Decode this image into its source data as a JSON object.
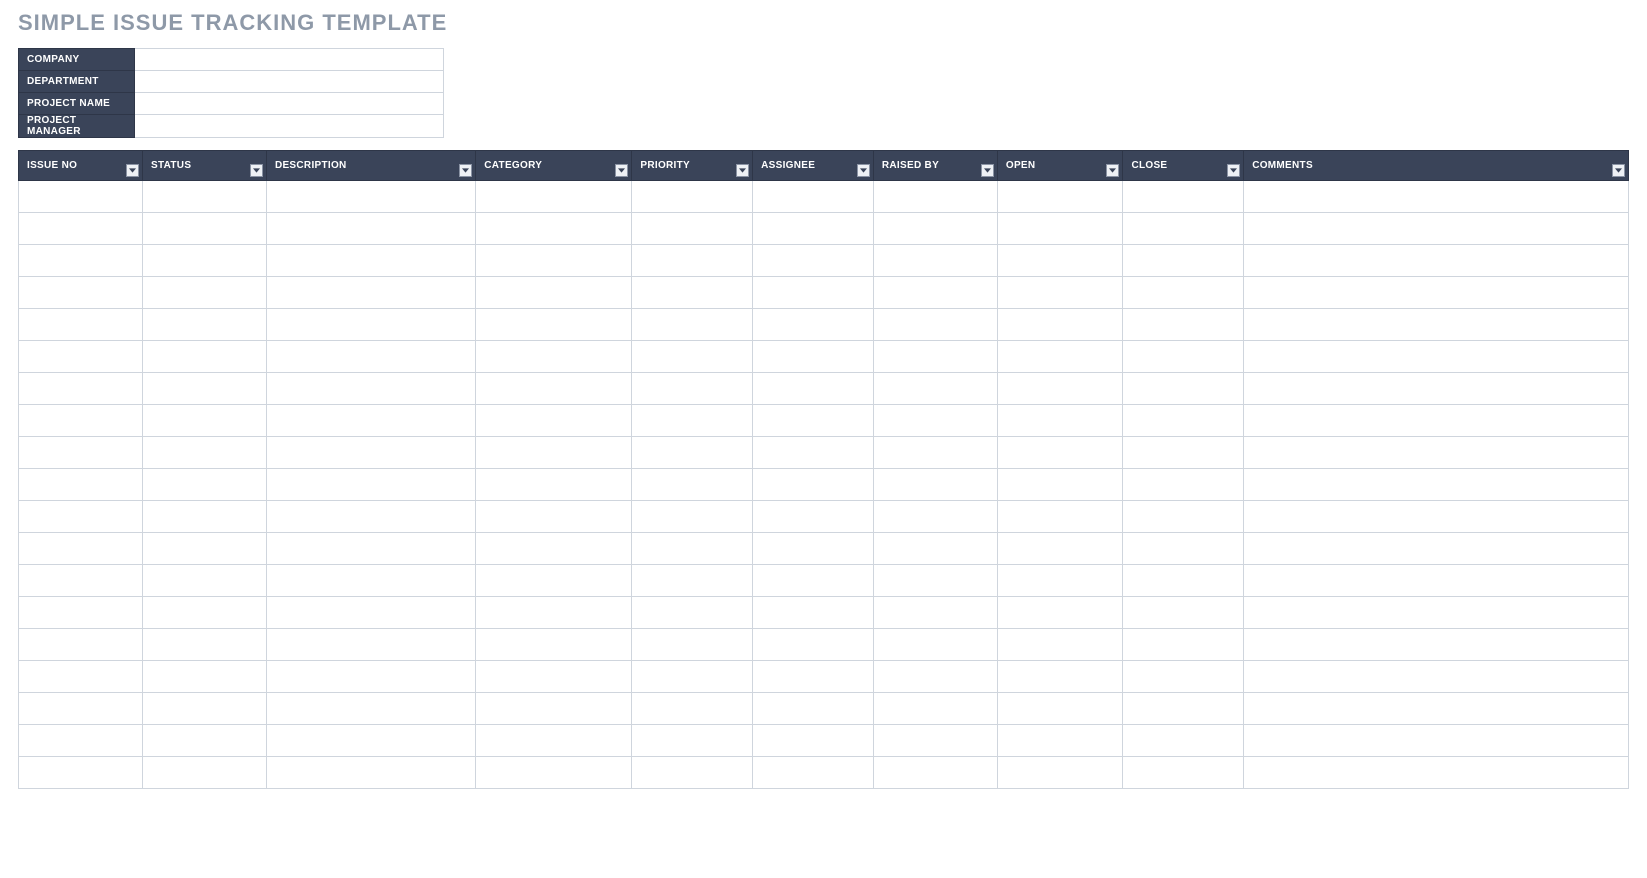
{
  "title": "SIMPLE ISSUE TRACKING TEMPLATE",
  "info": {
    "rows": [
      {
        "label": "COMPANY",
        "value": ""
      },
      {
        "label": "DEPARTMENT",
        "value": ""
      },
      {
        "label": "PROJECT NAME",
        "value": ""
      },
      {
        "label": "PROJECT MANAGER",
        "value": ""
      }
    ]
  },
  "columns": [
    {
      "key": "issue_no",
      "label": "ISSUE NO",
      "col_class": "c-issue"
    },
    {
      "key": "status",
      "label": "STATUS",
      "col_class": "c-status"
    },
    {
      "key": "description",
      "label": "DESCRIPTION",
      "col_class": "c-desc"
    },
    {
      "key": "category",
      "label": "CATEGORY",
      "col_class": "c-cat"
    },
    {
      "key": "priority",
      "label": "PRIORITY",
      "col_class": "c-prio"
    },
    {
      "key": "assignee",
      "label": "ASSIGNEE",
      "col_class": "c-assignee"
    },
    {
      "key": "raised_by",
      "label": "RAISED BY",
      "col_class": "c-raised"
    },
    {
      "key": "open",
      "label": "OPEN",
      "col_class": "c-open"
    },
    {
      "key": "close",
      "label": "CLOSE",
      "col_class": "c-close"
    },
    {
      "key": "comments",
      "label": "COMMENTS",
      "col_class": "c-comments"
    }
  ],
  "rows": [
    {
      "issue_no": "",
      "status": "",
      "description": "",
      "category": "",
      "priority": "",
      "assignee": "",
      "raised_by": "",
      "open": "",
      "close": "",
      "comments": ""
    },
    {
      "issue_no": "",
      "status": "",
      "description": "",
      "category": "",
      "priority": "",
      "assignee": "",
      "raised_by": "",
      "open": "",
      "close": "",
      "comments": ""
    },
    {
      "issue_no": "",
      "status": "",
      "description": "",
      "category": "",
      "priority": "",
      "assignee": "",
      "raised_by": "",
      "open": "",
      "close": "",
      "comments": ""
    },
    {
      "issue_no": "",
      "status": "",
      "description": "",
      "category": "",
      "priority": "",
      "assignee": "",
      "raised_by": "",
      "open": "",
      "close": "",
      "comments": ""
    },
    {
      "issue_no": "",
      "status": "",
      "description": "",
      "category": "",
      "priority": "",
      "assignee": "",
      "raised_by": "",
      "open": "",
      "close": "",
      "comments": ""
    },
    {
      "issue_no": "",
      "status": "",
      "description": "",
      "category": "",
      "priority": "",
      "assignee": "",
      "raised_by": "",
      "open": "",
      "close": "",
      "comments": ""
    },
    {
      "issue_no": "",
      "status": "",
      "description": "",
      "category": "",
      "priority": "",
      "assignee": "",
      "raised_by": "",
      "open": "",
      "close": "",
      "comments": ""
    },
    {
      "issue_no": "",
      "status": "",
      "description": "",
      "category": "",
      "priority": "",
      "assignee": "",
      "raised_by": "",
      "open": "",
      "close": "",
      "comments": ""
    },
    {
      "issue_no": "",
      "status": "",
      "description": "",
      "category": "",
      "priority": "",
      "assignee": "",
      "raised_by": "",
      "open": "",
      "close": "",
      "comments": ""
    },
    {
      "issue_no": "",
      "status": "",
      "description": "",
      "category": "",
      "priority": "",
      "assignee": "",
      "raised_by": "",
      "open": "",
      "close": "",
      "comments": ""
    },
    {
      "issue_no": "",
      "status": "",
      "description": "",
      "category": "",
      "priority": "",
      "assignee": "",
      "raised_by": "",
      "open": "",
      "close": "",
      "comments": ""
    },
    {
      "issue_no": "",
      "status": "",
      "description": "",
      "category": "",
      "priority": "",
      "assignee": "",
      "raised_by": "",
      "open": "",
      "close": "",
      "comments": ""
    },
    {
      "issue_no": "",
      "status": "",
      "description": "",
      "category": "",
      "priority": "",
      "assignee": "",
      "raised_by": "",
      "open": "",
      "close": "",
      "comments": ""
    },
    {
      "issue_no": "",
      "status": "",
      "description": "",
      "category": "",
      "priority": "",
      "assignee": "",
      "raised_by": "",
      "open": "",
      "close": "",
      "comments": ""
    },
    {
      "issue_no": "",
      "status": "",
      "description": "",
      "category": "",
      "priority": "",
      "assignee": "",
      "raised_by": "",
      "open": "",
      "close": "",
      "comments": ""
    },
    {
      "issue_no": "",
      "status": "",
      "description": "",
      "category": "",
      "priority": "",
      "assignee": "",
      "raised_by": "",
      "open": "",
      "close": "",
      "comments": ""
    },
    {
      "issue_no": "",
      "status": "",
      "description": "",
      "category": "",
      "priority": "",
      "assignee": "",
      "raised_by": "",
      "open": "",
      "close": "",
      "comments": ""
    },
    {
      "issue_no": "",
      "status": "",
      "description": "",
      "category": "",
      "priority": "",
      "assignee": "",
      "raised_by": "",
      "open": "",
      "close": "",
      "comments": ""
    },
    {
      "issue_no": "",
      "status": "",
      "description": "",
      "category": "",
      "priority": "",
      "assignee": "",
      "raised_by": "",
      "open": "",
      "close": "",
      "comments": ""
    }
  ]
}
